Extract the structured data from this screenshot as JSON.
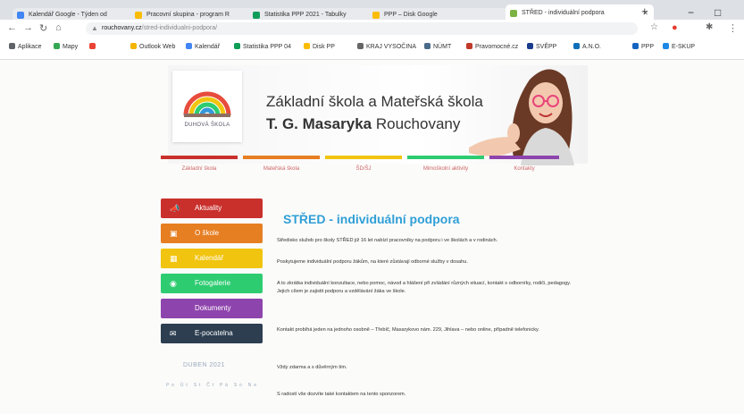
{
  "browser": {
    "tabs": [
      {
        "title": "Kalendář Google - Týden od",
        "color": "#4285f4"
      },
      {
        "title": "Pracovní skupina - program R",
        "color": "#fbbc04"
      },
      {
        "title": "Statistika PPP 2021 - Tabulky",
        "color": "#0f9d58"
      },
      {
        "title": "PPP – Disk Google",
        "color": "#fbbc04"
      },
      {
        "title": "STŘED - individuální podpora",
        "color": "#7cb342",
        "active": true
      }
    ],
    "url_host": "rouchovany.cz",
    "url_path": "/stred-individualni-podpora/",
    "bookmarks": [
      {
        "label": "Aplikace",
        "color": "#5f6368"
      },
      {
        "label": "Mapy",
        "color": "#34a853"
      },
      {
        "label": "",
        "color": "#ea4335"
      },
      {
        "label": "Outlook Web",
        "color": "#f4b400"
      },
      {
        "label": "Kalendář",
        "color": "#4285f4"
      },
      {
        "label": "Statistika PPP 04",
        "color": "#0f9d58"
      },
      {
        "label": "Disk PP",
        "color": "#fbbc04"
      },
      {
        "label": "KRAJ VYSOČINA",
        "color": "#666666"
      },
      {
        "label": "NÚMT",
        "color": "#4a6a8a"
      },
      {
        "label": "Pravomocné.cz",
        "color": "#c0392b"
      },
      {
        "label": "SVĚPP",
        "color": "#1a3c8c"
      },
      {
        "label": "A.N.O.",
        "color": "#0b6fb8"
      },
      {
        "label": "PPP",
        "color": "#1565c0"
      },
      {
        "label": "E-SKUP",
        "color": "#1e88e5"
      }
    ]
  },
  "school": {
    "logo_text": "DUHOVÁ ŠKOLA",
    "name_line1": "Základní škola a Mateřská škola",
    "name_line2_bold": "T. G. Masaryka",
    "name_line2_rest": " Rouchovany"
  },
  "topnav": [
    {
      "label": "Základní škola",
      "color": "#c9302c"
    },
    {
      "label": "Mateřská škola",
      "color": "#e67e22"
    },
    {
      "label": "ŠD/ŠJ",
      "color": "#f1c40f"
    },
    {
      "label": "Mimoškolní aktivity",
      "color": "#2ecc71"
    },
    {
      "label": "Kontakty",
      "color": "#8e44ad"
    }
  ],
  "sidebar": [
    {
      "label": "Aktuality",
      "color": "#c9302c",
      "icon": "megaphone-icon",
      "glyph": "📣"
    },
    {
      "label": "O škole",
      "color": "#e67e22",
      "icon": "school-icon",
      "glyph": "▣"
    },
    {
      "label": "Kalendář",
      "color": "#f1c40f",
      "icon": "calendar-icon",
      "glyph": "▦"
    },
    {
      "label": "Fotogalerie",
      "color": "#2ecc71",
      "icon": "camera-icon",
      "glyph": "◉"
    },
    {
      "label": "Dokumenty",
      "color": "#8e44ad",
      "icon": "document-icon",
      "glyph": ""
    },
    {
      "label": "E-pocatelna",
      "color": "#2c3e50",
      "icon": "mail-icon",
      "glyph": "✉"
    }
  ],
  "calendar": {
    "title": "DUBEN 2021",
    "days": "Po Út St Čt Pá So Ne"
  },
  "content": {
    "heading": "STŘED - individuální podpora",
    "p1": "Středisko služeb pro školy STŘED již 16 let nabízí pracovníky na podporu i ve školách a v rodinách.",
    "p2": "Poskytujeme individuální podporu žákům, na které zůstávají odborné služby v dosahu.",
    "p3": "A to zkrátka individuální konzultace, nebo pomoc, návod a hlášení při zvládání různých situací, kontakt s odborníky, rodiči, pedagogy. Jejich cílem je zajistit podporu a vzdělávání žáka ve škole.",
    "p4": "Kontakt probíhá jeden na jednoho osobně – Třebíč, Masarykovo nám. 229, Jihlava – nebo online, případně telefonicky.",
    "p5": "Vždy zdarma a s důvěrným tím.",
    "p6": "S radostí vše dozvíte také kontaktem na tento sponzorem."
  },
  "window": {
    "minimize": "−",
    "maximize": "□"
  }
}
